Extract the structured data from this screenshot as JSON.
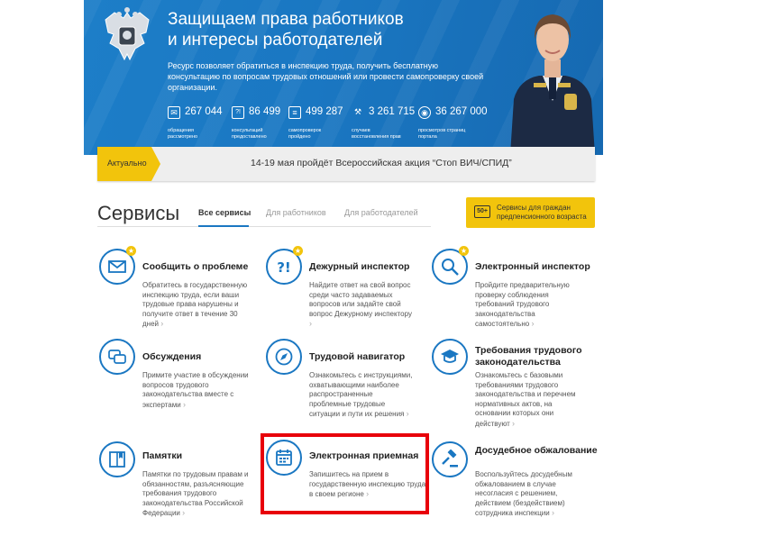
{
  "hero": {
    "title_line1": "Защищаем права работников",
    "title_line2": "и интересы работодателей",
    "subtitle": "Ресурс позволяет обратиться в инспекцию труда, получить бесплатную консультацию по вопросам трудовых отношений или провести самопроверку своей организации.",
    "stats": [
      {
        "icon": "envelope-icon",
        "glyph": "✉",
        "value": "267 044",
        "caption": "обращения рассмотрено"
      },
      {
        "icon": "question-icon",
        "glyph": "?!",
        "value": "86 499",
        "caption": "консультаций предоставлено"
      },
      {
        "icon": "document-icon",
        "glyph": "≡",
        "value": "499 287",
        "caption": "самопроверок пройдено"
      },
      {
        "icon": "gavel-icon",
        "glyph": "⚒",
        "value": "3 261 715",
        "caption": "случаев восстановления прав"
      },
      {
        "icon": "eye-icon",
        "glyph": "◉",
        "value": "36 267 000",
        "caption": "просмотров страниц портала"
      }
    ]
  },
  "notice": {
    "tag": "Актуально",
    "message": "14-19 мая пройдёт Всероссийская акция “Стоп ВИЧ/СПИД”"
  },
  "services": {
    "title": "Сервисы",
    "tabs": [
      "Все сервисы",
      "Для работников",
      "Для работодателей"
    ],
    "senior_badge": "50+",
    "senior_text": "Сервисы для граждан предпенсионного возраста",
    "cards": [
      {
        "title": "Сообщить о проблеме",
        "desc": "Обратитесь в государственную инспекцию труда, если ваши трудовые права нарушены и получите ответ в течение 30 дней",
        "icon": "envelope-icon",
        "star": "★"
      },
      {
        "title": "Дежурный инспектор",
        "desc": "Найдите ответ на свой вопрос среди часто задаваемых вопросов или задайте свой вопрос Дежурному инспектору",
        "icon": "question-icon",
        "star": "★"
      },
      {
        "title": "Электронный инспектор",
        "desc": "Пройдите предварительную проверку соблюдения требований трудового законодательства самостоятельно",
        "icon": "search-icon",
        "star": "★"
      },
      {
        "title": "Обсуждения",
        "desc": "Примите участие в обсуждении вопросов трудового законодательства вместе с экспертами",
        "icon": "chat-icon"
      },
      {
        "title": "Трудовой навигатор",
        "desc": "Ознакомьтесь с инструкциями, охватывающими наиболее распространенные проблемные трудовые ситуации и пути их решения",
        "icon": "compass-icon"
      },
      {
        "title": "Требования трудового законодательства",
        "desc": "Ознакомьтесь с базовыми требованиями трудового законодательства и перечнем нормативных актов, на основании которых они действуют",
        "icon": "graduation-cap-icon"
      },
      {
        "title": "Памятки",
        "desc": "Памятки по трудовым правам и обязанностям, разъясняющие требования трудового законодательства Российской Федерации",
        "icon": "book-icon"
      },
      {
        "title": "Электронная приемная",
        "desc": "Запишитесь на прием в государственную инспекцию труда в своем регионе",
        "icon": "calendar-icon"
      },
      {
        "title": "Досудебное обжалование",
        "desc": "Воспользуйтесь досудебным обжалованием в случае несогласия с решением, действием (бездействием) сотрудника инспекции",
        "icon": "gavel-icon"
      }
    ],
    "arrow": "›"
  },
  "colors": {
    "brand_blue": "#1a77c2",
    "accent_yellow": "#f2c40c",
    "highlight_red": "#e8000a"
  }
}
